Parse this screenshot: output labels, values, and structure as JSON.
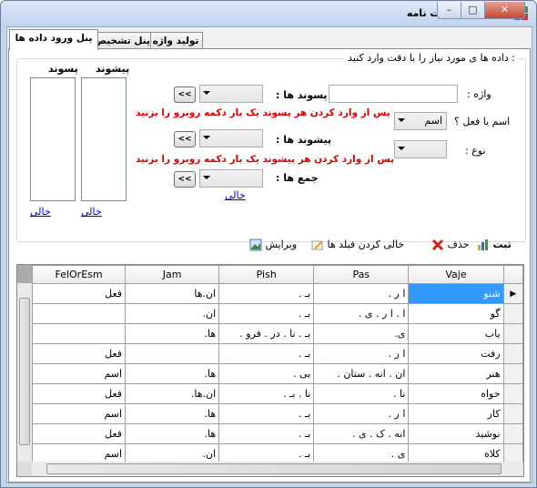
{
  "window": {
    "title": "نرم افزار لغت نامه",
    "minimize": "–",
    "maximize": "□",
    "close": "✕"
  },
  "tabs": [
    {
      "label": "پنل ورود داده ها"
    },
    {
      "label": "پنل تشخیص"
    },
    {
      "label": "تولید واژه"
    }
  ],
  "form": {
    "group_label": ": داده ها ی مورد نیاز را با دقت وارد کنید",
    "vaje_label": "واژه :",
    "vaje_value": "",
    "esm_fel_label": "اسم یا فعل ؟",
    "esm_fel_value": "اسم",
    "noe_label": "نوع :",
    "noe_value": "",
    "pasvand_label": "پسوند ها :",
    "pasvand_hint": "پس از وارد کردن هر پسوند یک بار دکمه روبرو را بزنید",
    "pishvand_label": "پیشوند ها :",
    "pishvand_hint": "پس از وارد کردن هر پیشوند یک بار دکمه روبرو را بزنید",
    "jam_label": "جمع ها :",
    "add_button": "<<",
    "list_pishvand_label": "پیشوند",
    "list_pasvand_label": "پسوند",
    "clear_link": "خالی"
  },
  "toolbar": {
    "save": "ثبت",
    "delete": "حذف",
    "clear": "خالی کردن فیلد ها",
    "edit": "ویرایش"
  },
  "grid": {
    "columns": [
      "FelOrEsm",
      "Jam",
      "Pish",
      "Pas",
      "Vaje"
    ],
    "current_row_marker": "▶",
    "rows": [
      {
        "Vaje": "شنو",
        "Pas": "ا ر .",
        "Pish": "بـ .",
        "Jam": "ان.ها",
        "FelOrEsm": "فعل"
      },
      {
        "Vaje": "گو",
        "Pas": "ا . ا ر . ی .",
        "Pish": "بـ .",
        "Jam": "ان.",
        "FelOrEsm": ""
      },
      {
        "Vaje": "یاب",
        "Pas": "ی.",
        "Pish": "بـ . نا . در . فرو .",
        "Jam": "ها.",
        "FelOrEsm": ""
      },
      {
        "Vaje": "رفت",
        "Pas": "ا ر .",
        "Pish": "بـ .",
        "Jam": "",
        "FelOrEsm": "فعل"
      },
      {
        "Vaje": "هنر",
        "Pas": "ان . انه . ستان .",
        "Pish": "بی .",
        "Jam": "ها.",
        "FelOrEsm": "اسم"
      },
      {
        "Vaje": "خواه",
        "Pas": "نا .",
        "Pish": "نا . بـ .",
        "Jam": "ان.ها.",
        "FelOrEsm": "فعل"
      },
      {
        "Vaje": "کار",
        "Pas": "ا ر .",
        "Pish": "بـ .",
        "Jam": "ها.",
        "FelOrEsm": "اسم"
      },
      {
        "Vaje": "نوشید",
        "Pas": "انه . ک . ی .",
        "Pish": "بـ .",
        "Jam": "ها.",
        "FelOrEsm": "فعل"
      },
      {
        "Vaje": "کلاه",
        "Pas": "ی .",
        "Pish": "بـ .",
        "Jam": "ان.",
        "FelOrEsm": "اسم"
      }
    ]
  },
  "colors": {
    "selection": "#3399ff",
    "hint_red": "#d80000",
    "link_blue": "#0000d0"
  }
}
